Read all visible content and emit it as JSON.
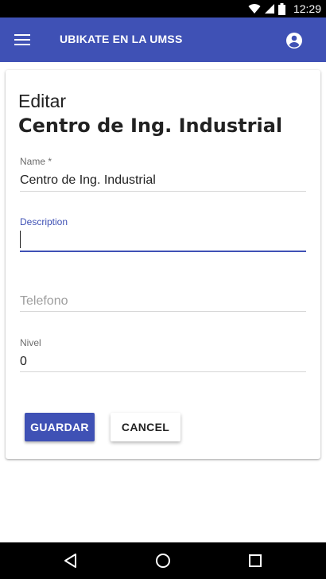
{
  "status_bar": {
    "time": "12:29"
  },
  "app_bar": {
    "title": "UBIKATE EN LA UMSS"
  },
  "card": {
    "subtitle": "Editar",
    "title": "Centro de Ing. Industrial"
  },
  "form": {
    "name": {
      "label": "Name *",
      "value": "Centro de Ing. Industrial"
    },
    "description": {
      "label": "Description",
      "value": ""
    },
    "telefono": {
      "placeholder": "Telefono"
    },
    "nivel": {
      "label": "Nivel",
      "value": "0"
    }
  },
  "buttons": {
    "save_label": "GUARDAR",
    "cancel_label": "CANCEL"
  },
  "colors": {
    "primary": "#3f51b5",
    "status_bar": "#000000"
  }
}
